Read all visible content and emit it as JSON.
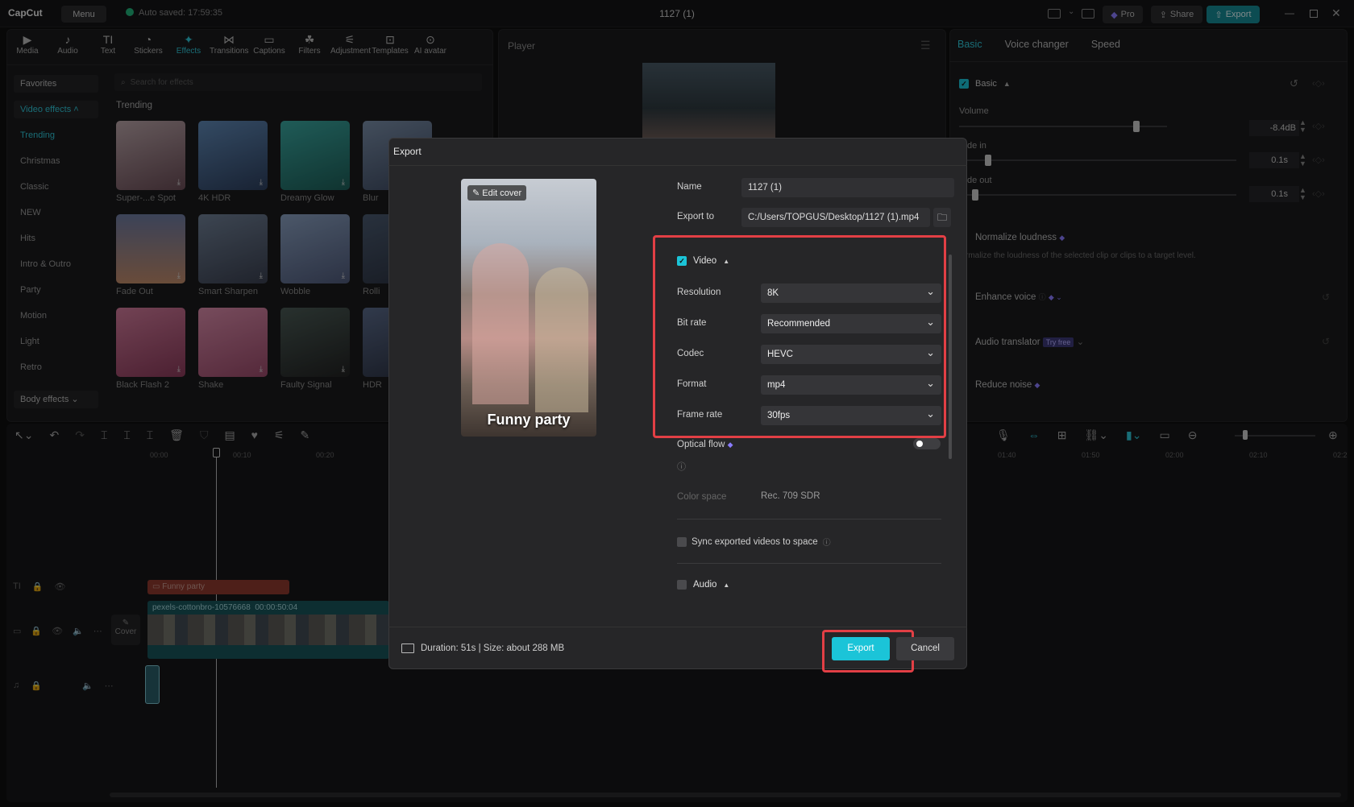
{
  "app": {
    "logo": "CapCut",
    "menu": "Menu",
    "autosave": "Auto saved: 17:59:35",
    "project_title": "1127 (1)",
    "pro": "Pro",
    "share": "Share",
    "export": "Export"
  },
  "toolbar": [
    {
      "label": "Media",
      "icon": "media-icon",
      "glyph": "▶"
    },
    {
      "label": "Audio",
      "icon": "audio-icon",
      "glyph": "♪"
    },
    {
      "label": "Text",
      "icon": "text-icon",
      "glyph": "TI"
    },
    {
      "label": "Stickers",
      "icon": "sticker-icon",
      "glyph": "◔"
    },
    {
      "label": "Effects",
      "icon": "effects-icon",
      "glyph": "✦"
    },
    {
      "label": "Transitions",
      "icon": "transitions-icon",
      "glyph": "⋈"
    },
    {
      "label": "Captions",
      "icon": "captions-icon",
      "glyph": "▭"
    },
    {
      "label": "Filters",
      "icon": "filters-icon",
      "glyph": "☘"
    },
    {
      "label": "Adjustment",
      "icon": "adjustment-icon",
      "glyph": "⚟"
    },
    {
      "label": "Templates",
      "icon": "templates-icon",
      "glyph": "⊡"
    },
    {
      "label": "AI avatar",
      "icon": "ai-avatar-icon",
      "glyph": "⊙"
    }
  ],
  "left": {
    "favorites": "Favorites",
    "video_effects": "Video effects",
    "search_placeholder": "Search for effects",
    "section": "Trending",
    "categories": [
      "Trending",
      "Christmas",
      "Classic",
      "NEW",
      "Hits",
      "Intro & Outro",
      "Party",
      "Motion",
      "Light",
      "Retro"
    ],
    "body_effects": "Body effects",
    "effects": [
      "Super-...e Spot",
      "4K HDR",
      "Dreamy Glow",
      "Blur",
      "Fade Out",
      "Smart Sharpen",
      "Wobble",
      "Rolli",
      "Black Flash 2",
      "Shake",
      "Faulty Signal",
      "HDR"
    ]
  },
  "player": {
    "title": "Player"
  },
  "right": {
    "tabs": [
      "Basic",
      "Voice changer",
      "Speed"
    ],
    "basic": "Basic",
    "volume": "Volume",
    "volume_value": "-8.4dB",
    "fade_in": "de in",
    "fade_in_value": "0.1s",
    "fade_out": "de out",
    "fade_out_value": "0.1s",
    "normalize": "Normalize loudness",
    "normalize_desc": "rmalize the loudness of the selected clip or clips to a target level.",
    "enhance": "Enhance voice",
    "translator": "Audio translator",
    "try_free": "Try free",
    "reduce_noise": "Reduce noise"
  },
  "timeline": {
    "ticks": [
      "00:00",
      "00:10",
      "00:20"
    ],
    "ticks_right": [
      "01:40",
      "01:50",
      "02:00",
      "02:10",
      "02:2"
    ],
    "text_clip": "Funny party",
    "video_clip": "pexels-cottonbro-10576668",
    "video_dur": "00:00:50:04",
    "cover": "Cover"
  },
  "export": {
    "title": "Export",
    "edit_cover": "Edit cover",
    "cover_caption": "Funny party",
    "name_label": "Name",
    "name_value": "1127 (1)",
    "export_to_label": "Export to",
    "export_to_value": "C:/Users/TOPGUS/Desktop/1127 (1).mp4",
    "video_section": "Video",
    "fields": [
      {
        "label": "Resolution",
        "value": "8K"
      },
      {
        "label": "Bit rate",
        "value": "Recommended"
      },
      {
        "label": "Codec",
        "value": "HEVC"
      },
      {
        "label": "Format",
        "value": "mp4"
      },
      {
        "label": "Frame rate",
        "value": "30fps"
      }
    ],
    "optical_flow": "Optical flow",
    "color_space_label": "Color space",
    "color_space_value": "Rec. 709 SDR",
    "sync_label": "Sync exported videos to space",
    "audio_section": "Audio",
    "summary": "Duration: 51s | Size: about 288 MB",
    "export_btn": "Export",
    "cancel_btn": "Cancel"
  },
  "colors": {
    "accent": "#1bc4d8",
    "highlight": "#e23f45"
  }
}
